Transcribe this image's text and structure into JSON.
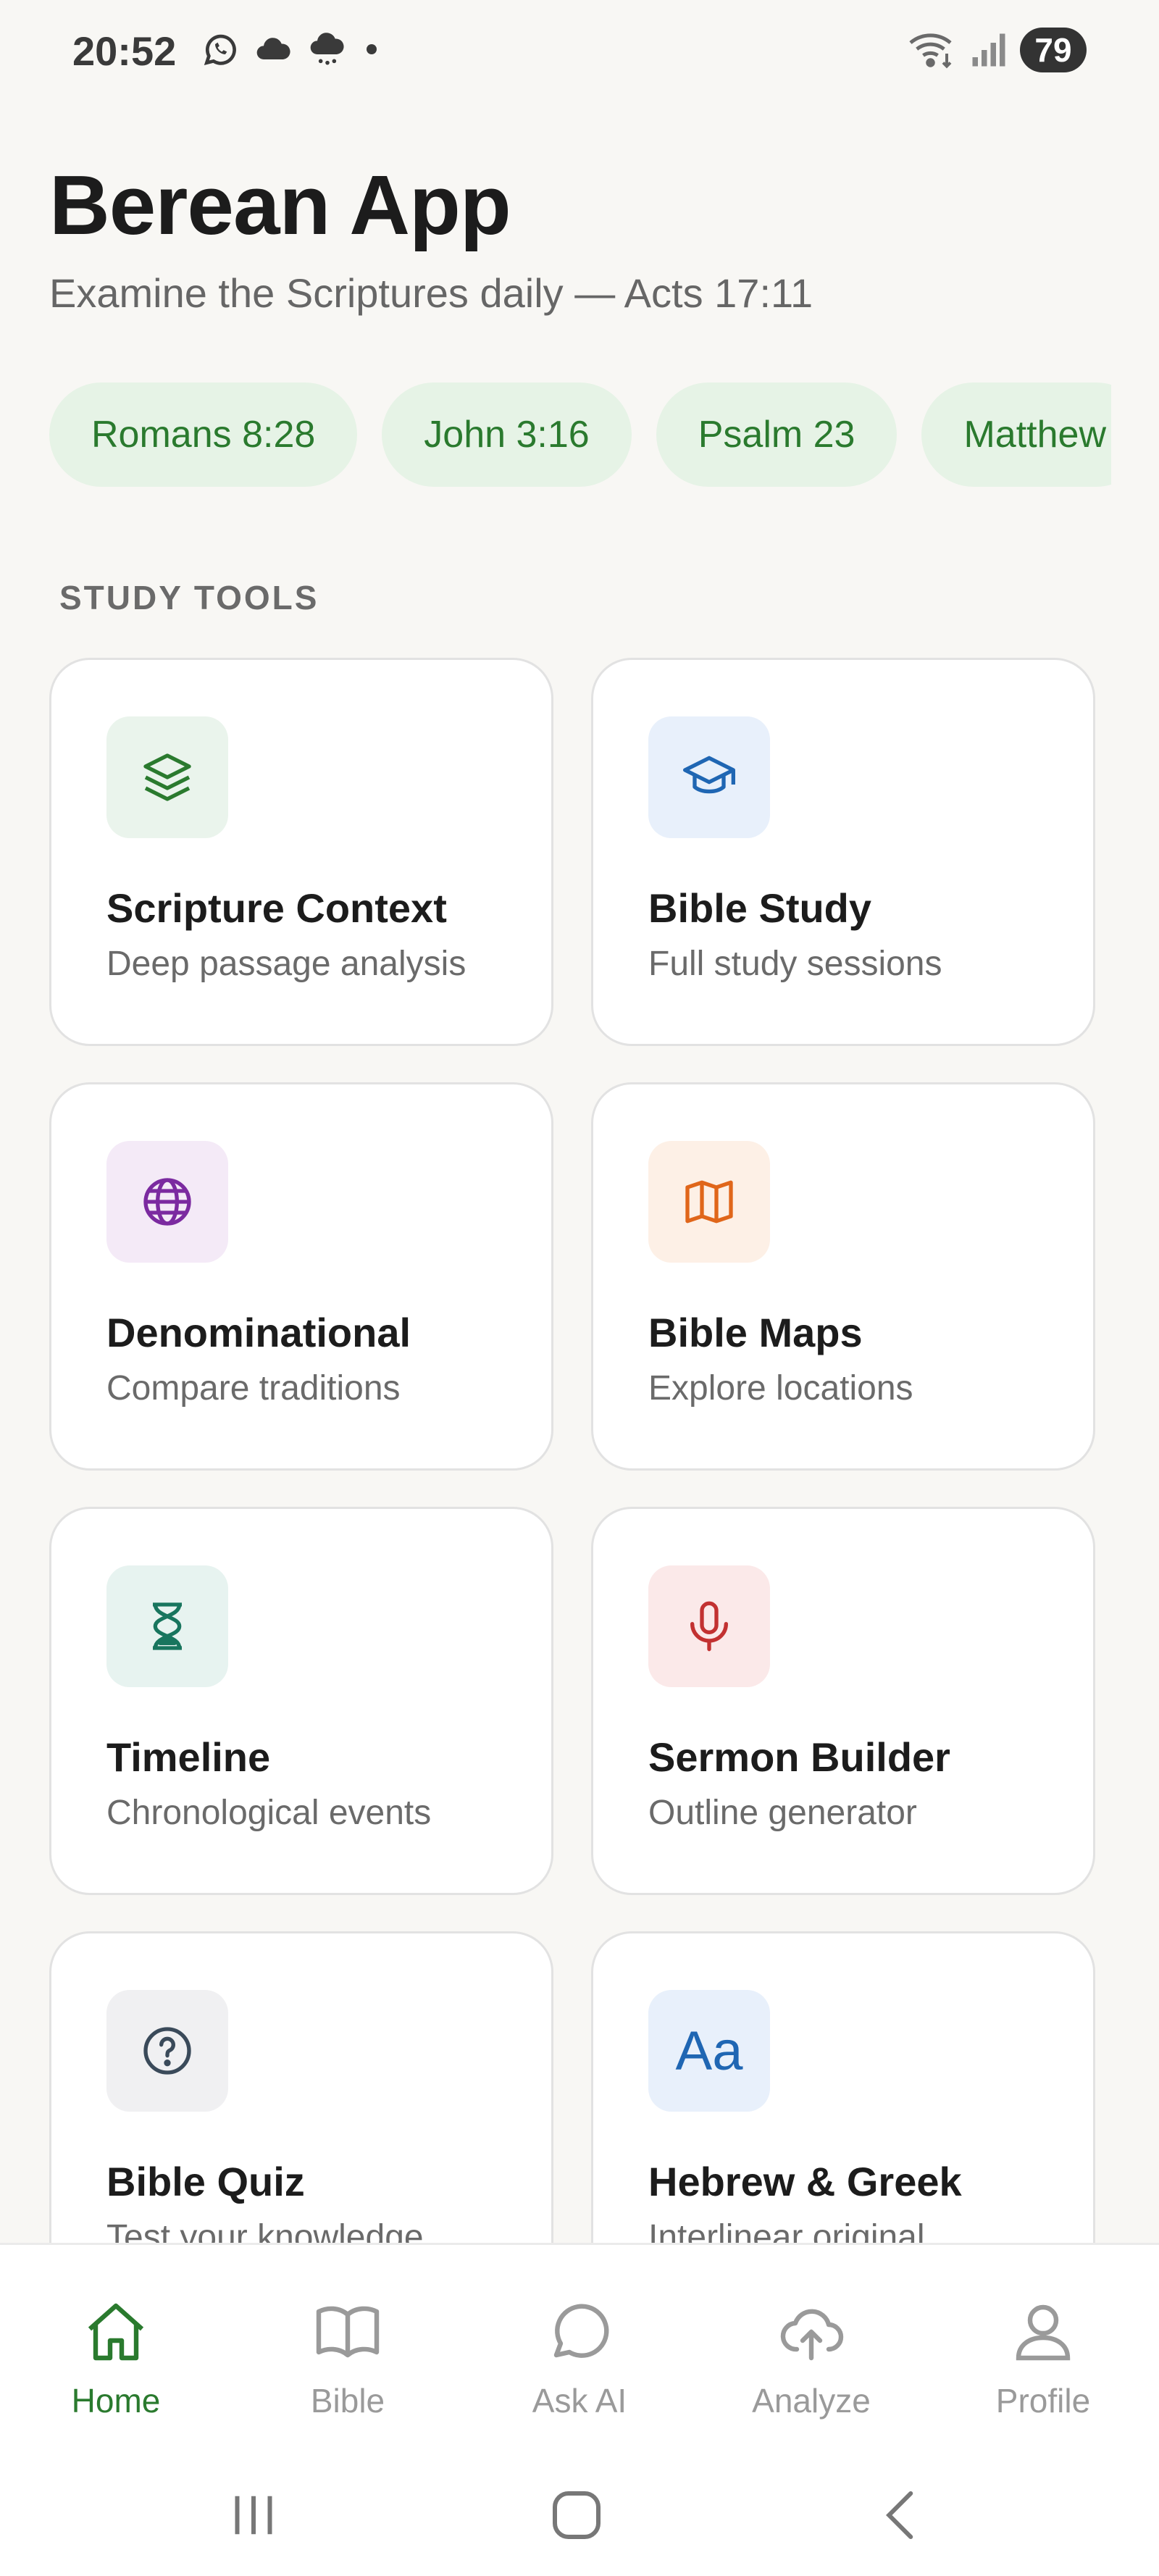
{
  "status_bar": {
    "time": "20:52",
    "battery": "79"
  },
  "header": {
    "title": "Berean App",
    "subtitle": "Examine the Scriptures daily — Acts 17:11"
  },
  "chips": [
    "Romans 8:28",
    "John 3:16",
    "Psalm 23",
    "Matthew"
  ],
  "study_tools": {
    "heading": "STUDY TOOLS",
    "items": [
      {
        "title": "Scripture Context",
        "desc": "Deep passage analysis",
        "icon": "layers-icon",
        "tint": "#eaf4ec",
        "color": "#2a7a2e"
      },
      {
        "title": "Bible Study",
        "desc": "Full study sessions",
        "icon": "graduation-cap-icon",
        "tint": "#e8f0fb",
        "color": "#1f66b3"
      },
      {
        "title": "Denominational",
        "desc": "Compare traditions",
        "icon": "globe-icon",
        "tint": "#f4eaf7",
        "color": "#7b2aa0"
      },
      {
        "title": "Bible Maps",
        "desc": "Explore locations",
        "icon": "map-icon",
        "tint": "#fdf0e6",
        "color": "#e0661a"
      },
      {
        "title": "Timeline",
        "desc": "Chronological events",
        "icon": "hourglass-icon",
        "tint": "#e7f3f0",
        "color": "#18755e"
      },
      {
        "title": "Sermon Builder",
        "desc": "Outline generator",
        "icon": "microphone-icon",
        "tint": "#fbe9e9",
        "color": "#c23131"
      },
      {
        "title": "Bible Quiz",
        "desc": "Test your knowledge",
        "icon": "question-circle-icon",
        "tint": "#f0f0f2",
        "color": "#3a4a5a"
      },
      {
        "title": "Hebrew & Greek",
        "desc": "Interlinear original",
        "icon": "text-aa-icon",
        "glyph": "Aa",
        "tint": "#e8f0fb",
        "color": "#1f66b3"
      }
    ]
  },
  "bottom_nav": {
    "active": "Home",
    "active_color": "#2a7a2e",
    "inactive_color": "#9a9a9a",
    "items": [
      {
        "label": "Home",
        "icon": "home-icon"
      },
      {
        "label": "Bible",
        "icon": "book-icon"
      },
      {
        "label": "Ask AI",
        "icon": "chat-bubble-icon"
      },
      {
        "label": "Analyze",
        "icon": "cloud-upload-icon"
      },
      {
        "label": "Profile",
        "icon": "person-icon"
      }
    ]
  }
}
